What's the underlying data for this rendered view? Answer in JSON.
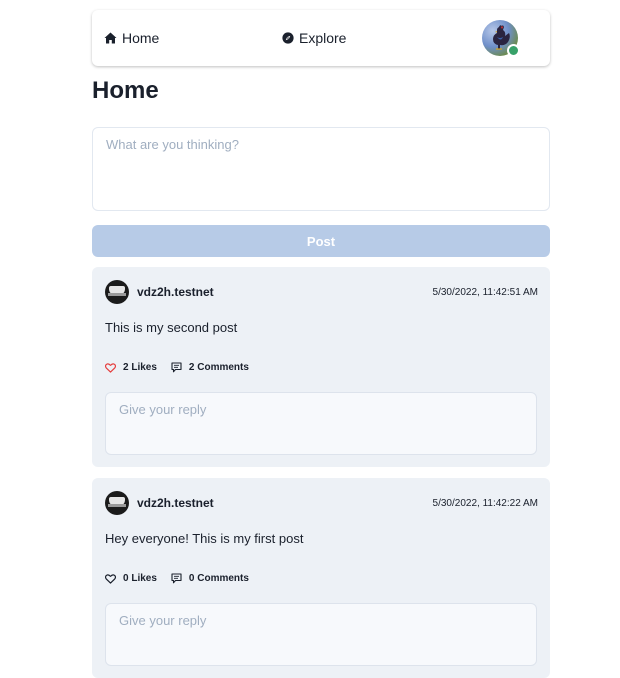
{
  "nav": {
    "home_label": "Home",
    "home_icon": "home-icon",
    "explore_label": "Explore",
    "explore_icon": "compass-icon",
    "avatar_status_color": "#38a169"
  },
  "page": {
    "title": "Home"
  },
  "composer": {
    "placeholder": "What are you thinking?",
    "value": "",
    "post_button_label": "Post"
  },
  "colors": {
    "post_button_bg": "#b7cbe7",
    "card_bg": "#edf1f6",
    "liked_heart": "#e53e3e"
  },
  "posts": [
    {
      "author": "vdz2h.testnet",
      "timestamp": "5/30/2022, 11:42:51 AM",
      "body": "This is my second post",
      "likes_label": "2 Likes",
      "liked": true,
      "comments_label": "2 Comments",
      "reply_placeholder": "Give your reply"
    },
    {
      "author": "vdz2h.testnet",
      "timestamp": "5/30/2022, 11:42:22 AM",
      "body": "Hey everyone! This is my first post",
      "likes_label": "0 Likes",
      "liked": false,
      "comments_label": "0 Comments",
      "reply_placeholder": "Give your reply"
    }
  ]
}
